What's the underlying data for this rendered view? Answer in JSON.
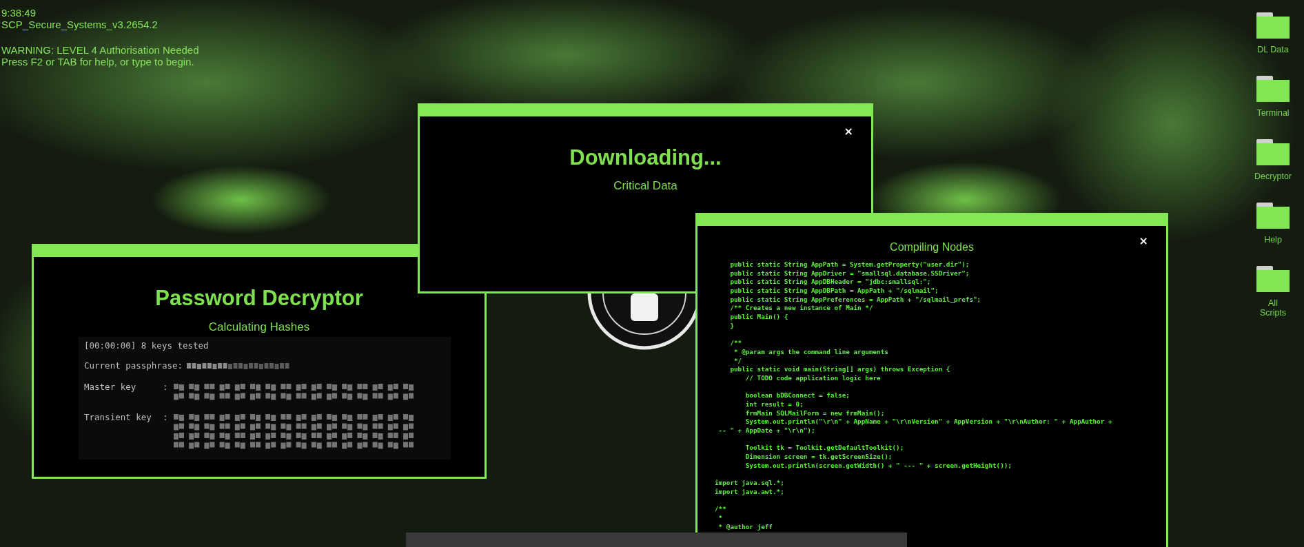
{
  "status": {
    "time": "9:38:49",
    "system": "SCP_Secure_Systems_v3.2654.2",
    "warning": "WARNING: LEVEL 4 Authorisation Needed",
    "prompt": "Press F2 or TAB for help, or type to begin."
  },
  "decryptor": {
    "title": "Password Decryptor",
    "subtitle": "Calculating Hashes",
    "tested": "[00:00:00] 8 keys tested",
    "passphrase_label": "Current passphrase:",
    "keys": [
      {
        "label": "Master key",
        "separator": ":"
      },
      {
        "label": "Transient key",
        "separator": ":"
      }
    ]
  },
  "download": {
    "title": "Downloading...",
    "subtitle": "Critical Data",
    "close": "×"
  },
  "compiler": {
    "title": "Compiling Nodes",
    "close": "×",
    "blocks": [
      [
        "    public static String AppPath = System.getProperty(\"user.dir\");",
        "    public static String AppDriver = \"smallsql.database.SSDriver\";",
        "    public static String AppDBHeader = \"jdbc:smallsql:\";",
        "    public static String AppDBPath = AppPath + \"/sqlmail\";",
        "    public static String AppPreferences = AppPath + \"/sqlmail_prefs\";",
        "    /** Creates a new instance of Main */",
        "    public Main() {",
        "    }"
      ],
      [
        "    /**",
        "     * @param args the command line arguments",
        "     */",
        "    public static void main(String[] args) throws Exception {",
        "        // TODO code application logic here"
      ],
      [
        "        boolean bDBConnect = false;",
        "        int result = 0;",
        "        frmMain SQLMailForm = new frmMain();",
        "        System.out.println(\"\\r\\n\" + AppName + \"\\r\\nVersion\" + AppVersion + \"\\r\\nAuthor: \" + AppAuthor +",
        " -- \" + AppDate + \"\\r\\n\");"
      ],
      [
        "        Toolkit tk = Toolkit.getDefaultToolkit();",
        "        Dimension screen = tk.getScreenSize();",
        "        System.out.println(screen.getWidth() + \" --- \" + screen.getHeight());"
      ],
      [
        "import java.sql.*;",
        "import java.awt.*;"
      ],
      [
        "/**",
        " *",
        " * @author jeff"
      ]
    ]
  },
  "desktop_icons": [
    {
      "label": "DL Data"
    },
    {
      "label": "Terminal"
    },
    {
      "label": "Decryptor"
    },
    {
      "label": "Help"
    },
    {
      "label": "All\nScripts"
    }
  ]
}
